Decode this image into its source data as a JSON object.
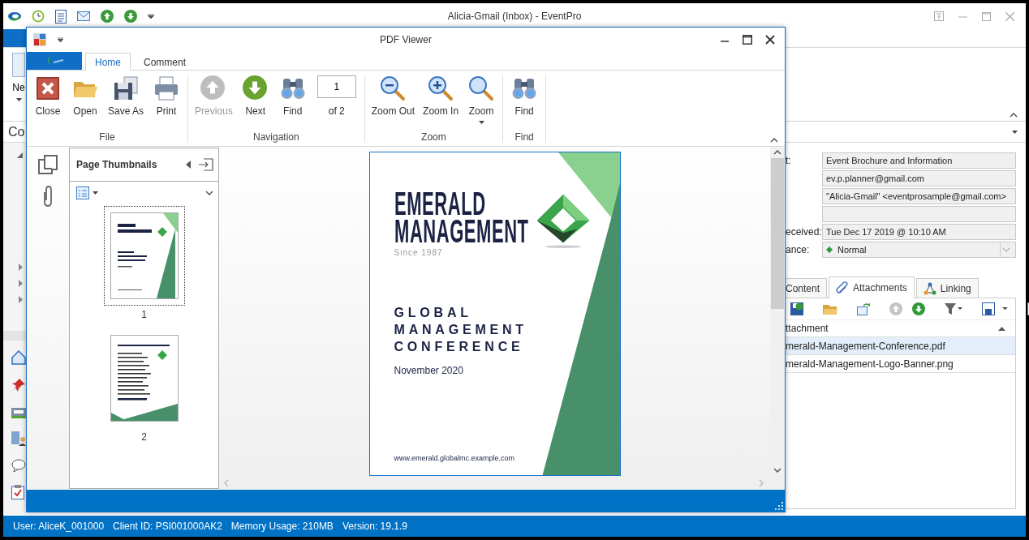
{
  "main_window": {
    "title": "Alicia-Gmail (Inbox) - EventPro",
    "ribbon_button": "Ne",
    "section_header": "Co"
  },
  "email_form": {
    "fields": [
      {
        "kind": "text",
        "label": "t:",
        "value": "Event Brochure and Information"
      },
      {
        "kind": "text",
        "value": "ev.p.planner@gmail.com"
      },
      {
        "kind": "text",
        "value": "\"Alicia-Gmail\" <eventprosample@gmail.com>"
      },
      {
        "kind": "text"
      },
      {
        "kind": "text",
        "label": "eceived:",
        "value": "Tue Dec 17 2019 @ 10:10 AM"
      },
      {
        "kind": "dropdown",
        "label": "ance:",
        "value": "Normal"
      }
    ]
  },
  "email_tabs": [
    {
      "label": "Content",
      "selected": false
    },
    {
      "label": "Attachments",
      "selected": true
    },
    {
      "label": "Linking",
      "selected": false
    }
  ],
  "attachments": {
    "column": "ttachment",
    "rows": [
      {
        "name": "merald-Management-Conference.pdf",
        "selected": true
      },
      {
        "name": "merald-Management-Logo-Banner.png",
        "selected": false
      }
    ]
  },
  "pdf_viewer": {
    "title": "PDF Viewer",
    "tabs": [
      {
        "label": "Home",
        "selected": true
      },
      {
        "label": "Comment",
        "selected": false
      }
    ],
    "ribbon_groups": [
      {
        "label": "File",
        "items": [
          {
            "kind": "button",
            "label": "Close",
            "disabled": false
          },
          {
            "kind": "button",
            "label": "Open",
            "disabled": false
          },
          {
            "kind": "button",
            "label": "Save As",
            "disabled": false
          },
          {
            "kind": "button",
            "label": "Print",
            "disabled": false
          }
        ]
      },
      {
        "label": "Navigation",
        "items": [
          {
            "kind": "button",
            "label": "Previous",
            "disabled": true
          },
          {
            "kind": "button",
            "label": "Next",
            "disabled": false
          },
          {
            "kind": "button",
            "label": "Find",
            "disabled": false
          },
          {
            "kind": "page_field",
            "value": "1",
            "label": "of 2"
          }
        ]
      },
      {
        "label": "Zoom",
        "items": [
          {
            "kind": "button",
            "label": "Zoom Out",
            "disabled": false
          },
          {
            "kind": "button",
            "label": "Zoom In",
            "disabled": false
          },
          {
            "kind": "dropdown",
            "label": "Zoom",
            "disabled": false
          }
        ]
      },
      {
        "label": "Find",
        "items": [
          {
            "kind": "button",
            "label": "Find",
            "disabled": false
          }
        ]
      }
    ],
    "thumbnails_panel": {
      "title": "Page Thumbnails",
      "pages": [
        {
          "label": "1",
          "selected": true
        },
        {
          "label": "2",
          "selected": false
        }
      ]
    },
    "document_page": {
      "title_lines": [
        "EMERALD",
        "MANAGEMENT"
      ],
      "tagline": "Since 1987",
      "event_lines": [
        "GLOBAL",
        "MANAGEMENT",
        "CONFERENCE"
      ],
      "date": "November 2020",
      "url": "www.emerald.globalmc.example.com"
    }
  },
  "status_bar": [
    "User: AliceK_001000",
    "Client ID: PSI001000AK2",
    "Memory Usage: 210MB",
    "Version: 19.1.9"
  ]
}
